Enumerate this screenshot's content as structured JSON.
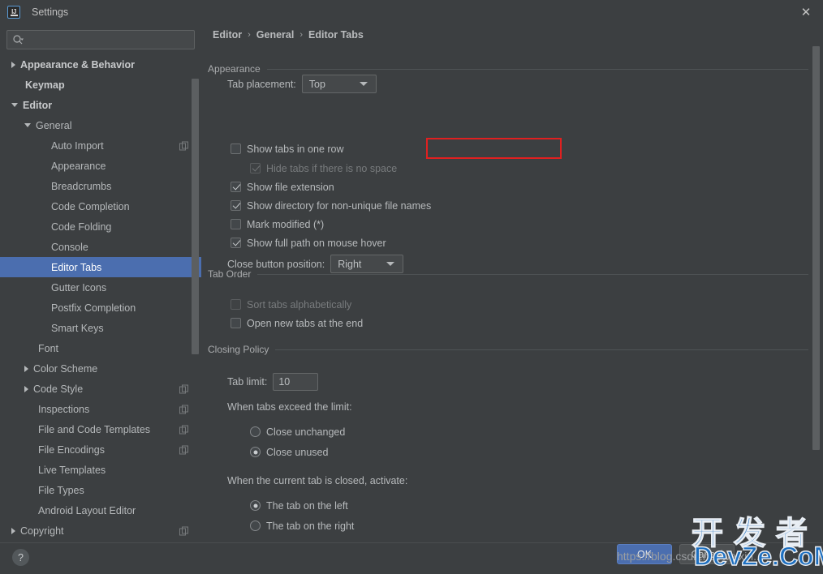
{
  "window": {
    "title": "Settings",
    "app_icon": "IJ",
    "close_icon": "✕"
  },
  "search": {
    "placeholder": "",
    "value": "",
    "icon": "search-icon"
  },
  "sidebar": {
    "items": [
      {
        "label": "Appearance & Behavior",
        "indent": 0,
        "arrow": "collapsed",
        "bold": true,
        "selected": false,
        "copy": false
      },
      {
        "label": "Keymap",
        "indent": 0,
        "arrow": "none",
        "bold": true,
        "selected": false,
        "copy": false
      },
      {
        "label": "Editor",
        "indent": 0,
        "arrow": "expanded",
        "bold": true,
        "selected": false,
        "copy": false
      },
      {
        "label": "General",
        "indent": 1,
        "arrow": "expanded",
        "bold": false,
        "selected": false,
        "copy": false
      },
      {
        "label": "Auto Import",
        "indent": 2,
        "arrow": "none",
        "bold": false,
        "selected": false,
        "copy": true
      },
      {
        "label": "Appearance",
        "indent": 2,
        "arrow": "none",
        "bold": false,
        "selected": false,
        "copy": false
      },
      {
        "label": "Breadcrumbs",
        "indent": 2,
        "arrow": "none",
        "bold": false,
        "selected": false,
        "copy": false
      },
      {
        "label": "Code Completion",
        "indent": 2,
        "arrow": "none",
        "bold": false,
        "selected": false,
        "copy": false
      },
      {
        "label": "Code Folding",
        "indent": 2,
        "arrow": "none",
        "bold": false,
        "selected": false,
        "copy": false
      },
      {
        "label": "Console",
        "indent": 2,
        "arrow": "none",
        "bold": false,
        "selected": false,
        "copy": false
      },
      {
        "label": "Editor Tabs",
        "indent": 2,
        "arrow": "none",
        "bold": false,
        "selected": true,
        "copy": false
      },
      {
        "label": "Gutter Icons",
        "indent": 2,
        "arrow": "none",
        "bold": false,
        "selected": false,
        "copy": false
      },
      {
        "label": "Postfix Completion",
        "indent": 2,
        "arrow": "none",
        "bold": false,
        "selected": false,
        "copy": false
      },
      {
        "label": "Smart Keys",
        "indent": 2,
        "arrow": "none",
        "bold": false,
        "selected": false,
        "copy": false
      },
      {
        "label": "Font",
        "indent": 1,
        "arrow": "none",
        "bold": false,
        "selected": false,
        "copy": false
      },
      {
        "label": "Color Scheme",
        "indent": 1,
        "arrow": "collapsed",
        "bold": false,
        "selected": false,
        "copy": false
      },
      {
        "label": "Code Style",
        "indent": 1,
        "arrow": "collapsed",
        "bold": false,
        "selected": false,
        "copy": true
      },
      {
        "label": "Inspections",
        "indent": 1,
        "arrow": "none",
        "bold": false,
        "selected": false,
        "copy": true
      },
      {
        "label": "File and Code Templates",
        "indent": 1,
        "arrow": "none",
        "bold": false,
        "selected": false,
        "copy": true
      },
      {
        "label": "File Encodings",
        "indent": 1,
        "arrow": "none",
        "bold": false,
        "selected": false,
        "copy": true
      },
      {
        "label": "Live Templates",
        "indent": 1,
        "arrow": "none",
        "bold": false,
        "selected": false,
        "copy": false
      },
      {
        "label": "File Types",
        "indent": 1,
        "arrow": "none",
        "bold": false,
        "selected": false,
        "copy": false
      },
      {
        "label": "Android Layout Editor",
        "indent": 1,
        "arrow": "none",
        "bold": false,
        "selected": false,
        "copy": false
      },
      {
        "label": "Copyright",
        "indent": 0,
        "arrow": "collapsed",
        "bold": false,
        "selected": false,
        "copy": true
      }
    ]
  },
  "breadcrumb": {
    "parts": [
      "Editor",
      "General",
      "Editor Tabs"
    ],
    "separator": "›"
  },
  "appearance": {
    "group_title": "Appearance",
    "tab_placement_label": "Tab placement:",
    "tab_placement_value": "Top",
    "show_tabs_one_row": {
      "label": "Show tabs in one row",
      "checked": false,
      "disabled": false,
      "highlighted": true
    },
    "hide_tabs_no_space": {
      "label": "Hide tabs if there is no space",
      "checked": true,
      "disabled": true
    },
    "show_file_extension": {
      "label": "Show file extension",
      "checked": true,
      "disabled": false
    },
    "show_directory": {
      "label": "Show directory for non-unique file names",
      "checked": true,
      "disabled": false
    },
    "mark_modified": {
      "label": "Mark modified (*)",
      "checked": false,
      "disabled": false
    },
    "show_full_path": {
      "label": "Show full path on mouse hover",
      "checked": true,
      "disabled": false
    },
    "close_button_label": "Close button position:",
    "close_button_value": "Right"
  },
  "tab_order": {
    "group_title": "Tab Order",
    "sort_alphabetically": {
      "label": "Sort tabs alphabetically",
      "checked": false,
      "disabled": true
    },
    "open_new_at_end": {
      "label": "Open new tabs at the end",
      "checked": false,
      "disabled": false
    }
  },
  "closing_policy": {
    "group_title": "Closing Policy",
    "tab_limit_label": "Tab limit:",
    "tab_limit_value": "10",
    "exceed_heading": "When tabs exceed the limit:",
    "exceed_options": [
      {
        "label": "Close unchanged",
        "selected": false
      },
      {
        "label": "Close unused",
        "selected": true
      }
    ],
    "closed_heading": "When the current tab is closed, activate:",
    "closed_options": [
      {
        "label": "The tab on the left",
        "selected": true
      },
      {
        "label": "The tab on the right",
        "selected": false
      }
    ]
  },
  "footer": {
    "help_label": "?",
    "ok_label": "OK",
    "cancel_label": "Cancel"
  },
  "watermark": {
    "url": "https://blog.csdn.net/weixin...",
    "cn": "开发者",
    "en": "DevZe.CoM"
  },
  "colors": {
    "background": "#3c3f41",
    "selection": "#4b6eaf",
    "text": "#b7babc",
    "highlight_box": "#e02020",
    "watermark": "#1d6fc0"
  }
}
